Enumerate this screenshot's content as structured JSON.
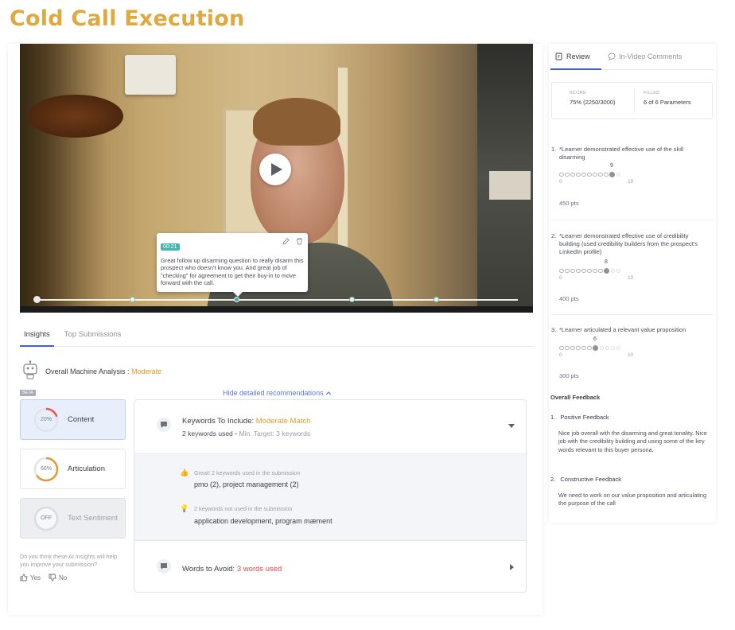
{
  "page_title": "Cold Call Execution",
  "video": {
    "comment": {
      "time": "00:21",
      "text": "Great follow up disarming question to really disarm this prospect who doesn't know you. And great job of \"checking\" for agreement to get their buy-in to move forward with the call."
    }
  },
  "tabs": [
    {
      "label": "Insights",
      "active": true
    },
    {
      "label": "Top Submissions",
      "active": false
    }
  ],
  "analysis": {
    "label": "Overall Machine Analysis :",
    "value": "Moderate",
    "beta": "BETA",
    "hide_recommendations": "Hide detailed recommendations"
  },
  "score_cards": [
    {
      "percent": "20%",
      "fill": 0.2,
      "label": "Content",
      "color": "#e05b4c",
      "state": "selected"
    },
    {
      "percent": "66%",
      "fill": 0.66,
      "label": "Articulation",
      "color": "#e9953a",
      "state": "normal"
    },
    {
      "percent": "OFF",
      "fill": 0,
      "label": "Text Sentiment",
      "color": "#c7cad0",
      "state": "off"
    }
  ],
  "ai_question": "Do you think these AI Insights will help you improve your submission?",
  "feedback_buttons": {
    "yes": "Yes",
    "no": "No"
  },
  "keywords": {
    "title": "Keywords To Include:",
    "match": "Moderate Match",
    "used": "2 keywords used",
    "min_target": "• Min. Target: 3 keywords",
    "used_heading": "Great! 2 keywords used in the submission",
    "used_list": "pmo (2), project management (2)",
    "not_used_heading": "2 keywords not used in the submission",
    "not_used_list": "application development, program mæment"
  },
  "avoid": {
    "title": "Words to Avoid:",
    "value": "3 words used"
  },
  "review": {
    "tabs": {
      "review": "Review",
      "comments": "In-Video Comments"
    },
    "score_label": "SCORE",
    "score_value": "75% (2250/3000)",
    "filled_label": "FILLED",
    "filled_value": "6 of 6 Parameters",
    "parameters": [
      {
        "num": "1.",
        "text": "*Learner demonstrated effective use of the skill disarming",
        "value": "9",
        "value_num": 9,
        "min": "0",
        "max": "10",
        "points": "450 pts"
      },
      {
        "num": "2.",
        "text": "*Learner demonstrated effective use of credibility building (used credibility builders from the prospect's LinkedIn profile)",
        "value": "8",
        "value_num": 8,
        "min": "0",
        "max": "10",
        "points": "400 pts"
      },
      {
        "num": "3.",
        "text": "*Learner articulated a relevant value proposition",
        "value": "6",
        "value_num": 6,
        "min": "0",
        "max": "10",
        "points": "300 pts"
      }
    ],
    "overall_feedback_title": "Overall Feedback",
    "feedback": [
      {
        "num": "1.",
        "heading": "Positive Feedback",
        "text": "Nice job overall with the disarming and great tonality. Nice job with the credibility building and using some of the key words relevant to this buyer persona."
      },
      {
        "num": "2.",
        "heading": "Constructive Feedback",
        "text": "We need to work on our value proposition and articulating the purpose of the call"
      }
    ]
  }
}
